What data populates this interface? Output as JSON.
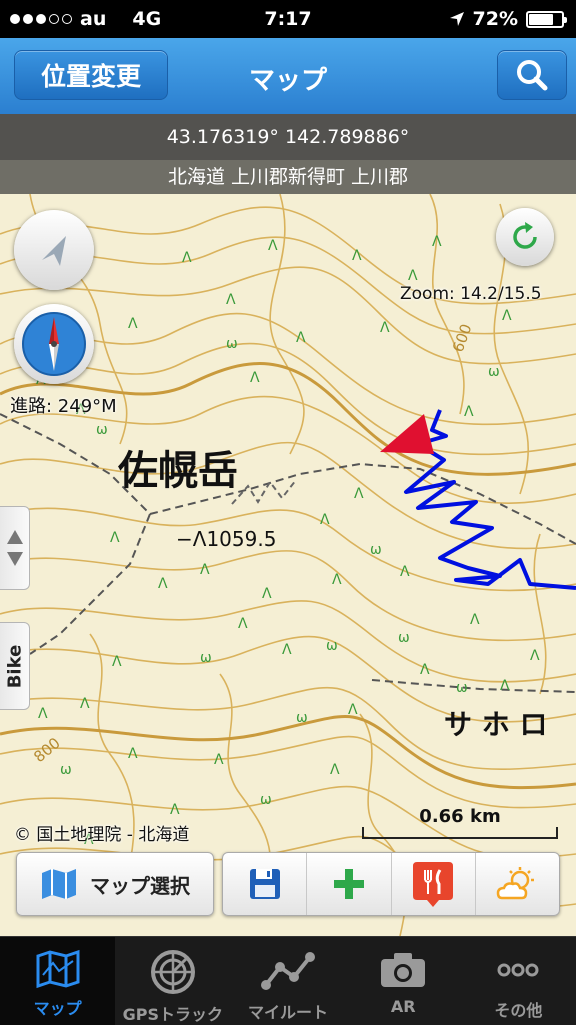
{
  "status_bar": {
    "carrier": "au",
    "network": "4G",
    "time": "7:17",
    "battery": "72%",
    "battery_level": 0.72,
    "signal_bars_filled": 3,
    "signal_bars_total": 5
  },
  "nav": {
    "left_button": "位置変更",
    "title": "マップ",
    "search_icon": "search-icon"
  },
  "map": {
    "coordinates": "43.176319° 142.789886°",
    "address": "北海道 上川郡新得町 上川郡",
    "zoom": "Zoom: 14.2/15.5",
    "heading": "進路: 249°M",
    "copyright": "© 国土地理院 - 北海道",
    "scale": "0.66 km",
    "peak_name": "佐幌岳",
    "elevation": "1059.5",
    "place_label": "サ ホ ロ",
    "contour_labels": [
      "600",
      "800"
    ],
    "side_tab_label": "Bike",
    "track_color": "#0010e0",
    "pointer_color": "#e01030"
  },
  "toolbar": {
    "map_select_label": "マップ選択",
    "icons": [
      "save-icon",
      "add-icon",
      "restaurant-icon",
      "weather-icon"
    ]
  },
  "tabs": [
    {
      "label": "マップ",
      "icon": "map-icon",
      "active": true
    },
    {
      "label": "GPSトラック",
      "icon": "radar-icon",
      "active": false
    },
    {
      "label": "マイルート",
      "icon": "route-icon",
      "active": false
    },
    {
      "label": "AR",
      "icon": "camera-icon",
      "active": false
    },
    {
      "label": "その他",
      "icon": "more-icon",
      "active": false
    }
  ],
  "colors": {
    "nav_blue": "#2b7fd0",
    "active_tab": "#2a8cf0",
    "inactive_tab": "#9a9a9a",
    "map_bg": "#f5efd4",
    "contour": "#d9b25c"
  }
}
